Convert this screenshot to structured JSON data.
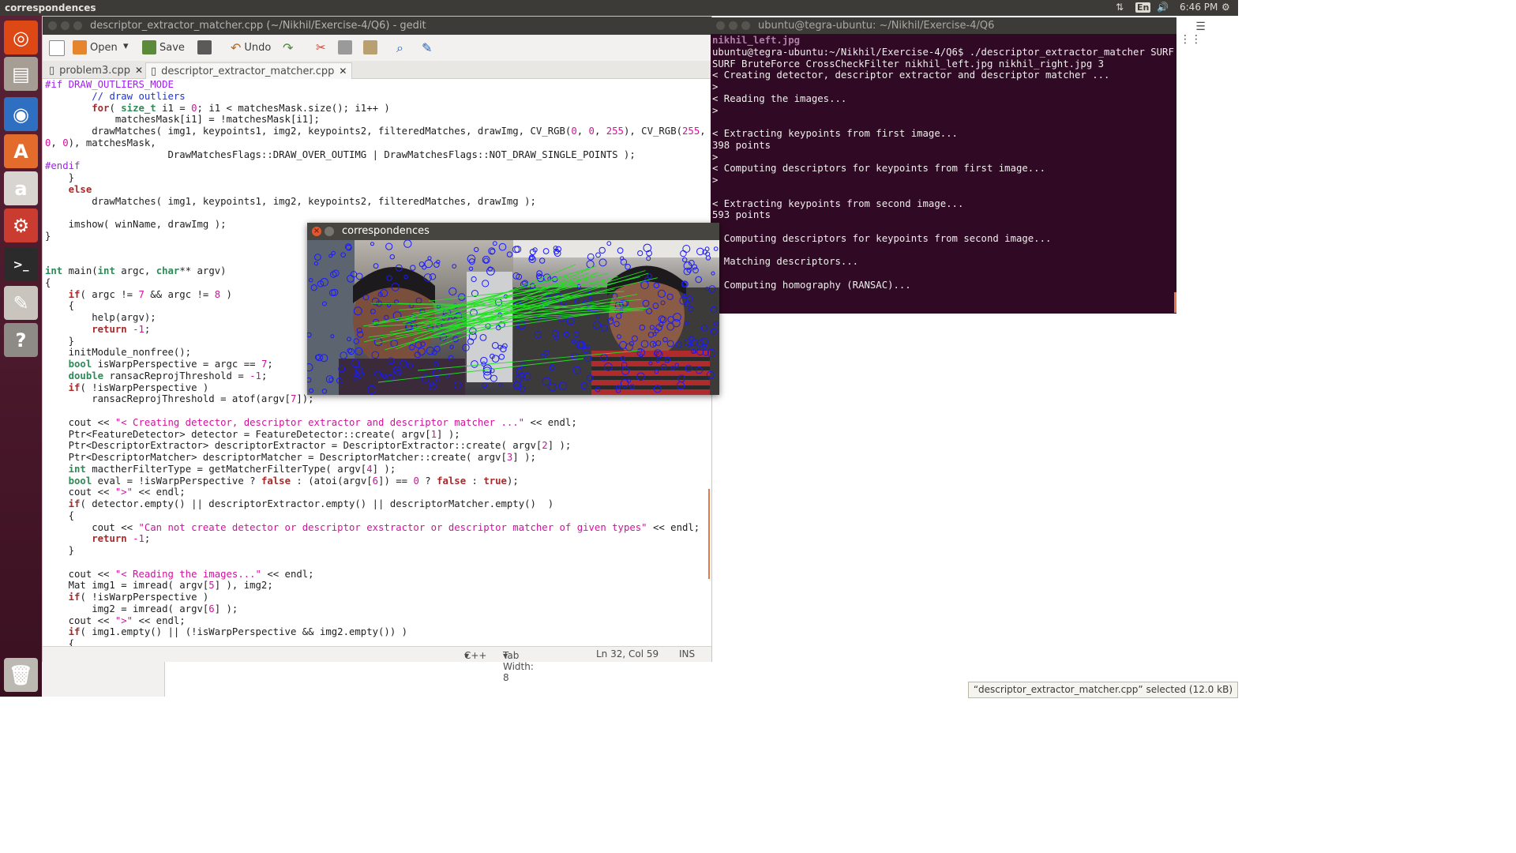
{
  "top_panel": {
    "app_title": "correspondences",
    "keyboard_layout": "En",
    "clock": "6:46 PM",
    "icons": [
      "network-arrows-icon",
      "volume-icon",
      "gear-icon"
    ]
  },
  "launcher": {
    "items": [
      {
        "name": "ubuntu-dash-icon",
        "glyph": "◎",
        "color": "#dd4814"
      },
      {
        "name": "files-icon",
        "glyph": "▤",
        "color": "#a69d94"
      },
      {
        "name": "chromium-icon",
        "glyph": "◉",
        "color": "#2f6fc2"
      },
      {
        "name": "software-center-icon",
        "glyph": "A",
        "color": "#e36b2c"
      },
      {
        "name": "amazon-icon",
        "glyph": "a",
        "color": "#d8d4cf"
      },
      {
        "name": "system-settings-icon",
        "glyph": "⚙",
        "color": "#c93c2f"
      },
      {
        "name": "terminal-icon",
        "glyph": ">_",
        "color": "#2b2b2b"
      },
      {
        "name": "text-editor-icon",
        "glyph": "✎",
        "color": "#c9c5be"
      },
      {
        "name": "help-icon",
        "glyph": "?",
        "color": "#8e8b86"
      },
      {
        "name": "trash-icon",
        "glyph": "🗑",
        "color": "#bcb8b2"
      }
    ]
  },
  "gedit": {
    "window_title": "descriptor_extractor_matcher.cpp (~/Nikhil/Exercise-4/Q6) - gedit",
    "toolbar": {
      "open_label": "Open",
      "save_label": "Save",
      "undo_label": "Undo"
    },
    "tabs": [
      {
        "label": "problem3.cpp"
      },
      {
        "label": "descriptor_extractor_matcher.cpp"
      }
    ],
    "status": {
      "language": "C++",
      "tab_width": "Tab Width: 8",
      "position": "Ln 32, Col 59",
      "mode": "INS"
    }
  },
  "terminal": {
    "window_title": "ubuntu@tegra-ubuntu: ~/Nikhil/Exercise-4/Q6",
    "lines": [
      "nikhil_left.jpg",
      "ubuntu@tegra-ubuntu:~/Nikhil/Exercise-4/Q6$ ./descriptor_extractor_matcher SURF",
      "SURF BruteForce CrossCheckFilter nikhil_left.jpg nikhil_right.jpg 3",
      "< Creating detector, descriptor extractor and descriptor matcher ...",
      ">",
      "< Reading the images...",
      ">",
      "",
      "< Extracting keypoints from first image...",
      "398 points",
      ">",
      "< Computing descriptors for keypoints from first image...",
      ">",
      "",
      "< Extracting keypoints from second image...",
      "593 points",
      ">",
      "< Computing descriptors for keypoints from second image...",
      ">",
      "< Matching descriptors...",
      ">",
      "< Computing homography (RANSAC)..."
    ]
  },
  "correspondences_window": {
    "title": "correspondences"
  },
  "file_selection_tip": "“descriptor_extractor_matcher.cpp” selected (12.0 kB)"
}
